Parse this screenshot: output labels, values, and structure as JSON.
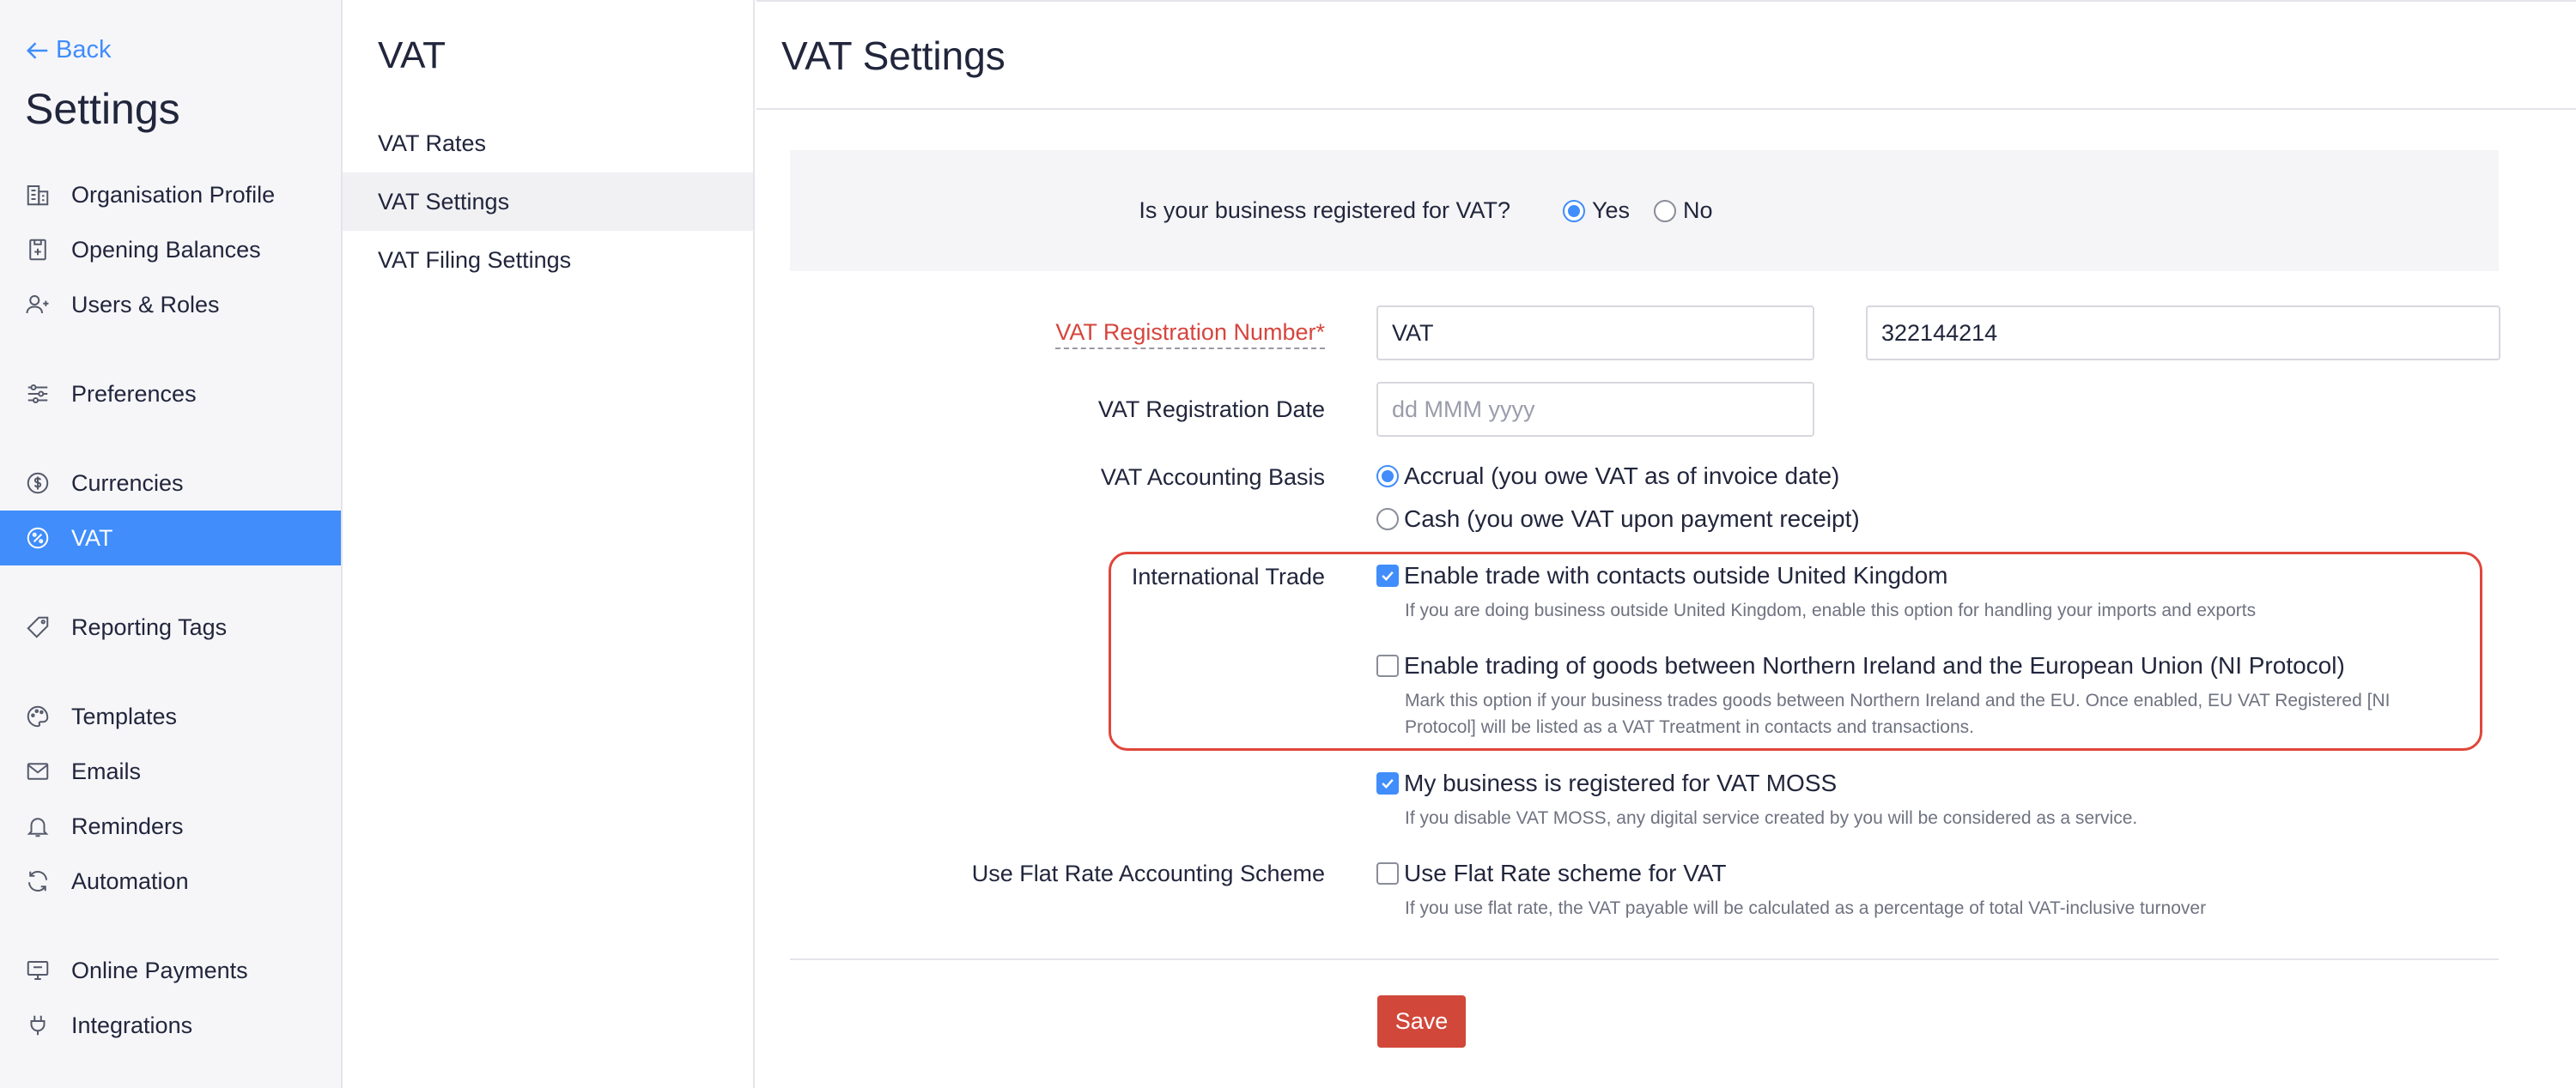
{
  "nav": {
    "back_label": "Back",
    "title": "Settings",
    "items": [
      {
        "label": "Organisation Profile",
        "icon": "building-icon"
      },
      {
        "label": "Opening Balances",
        "icon": "ledger-icon"
      },
      {
        "label": "Users & Roles",
        "icon": "users-icon"
      },
      {
        "label": "Preferences",
        "icon": "sliders-icon"
      },
      {
        "label": "Currencies",
        "icon": "currency-icon"
      },
      {
        "label": "VAT",
        "icon": "percent-icon"
      },
      {
        "label": "Reporting Tags",
        "icon": "tag-icon"
      },
      {
        "label": "Templates",
        "icon": "palette-icon"
      },
      {
        "label": "Emails",
        "icon": "mail-icon"
      },
      {
        "label": "Reminders",
        "icon": "bell-icon"
      },
      {
        "label": "Automation",
        "icon": "refresh-icon"
      },
      {
        "label": "Online Payments",
        "icon": "monitor-icon"
      },
      {
        "label": "Integrations",
        "icon": "plug-icon"
      }
    ],
    "active": "VAT"
  },
  "subnav": {
    "title": "VAT",
    "items": [
      "VAT Rates",
      "VAT Settings",
      "VAT Filing Settings"
    ],
    "active": "VAT Settings"
  },
  "main": {
    "title": "VAT Settings",
    "registered_question": "Is your business registered for VAT?",
    "yes_label": "Yes",
    "no_label": "No",
    "registered_value": "Yes",
    "reg_number_label": "VAT Registration Number*",
    "reg_prefix_value": "VAT",
    "reg_number_value": "322144214",
    "reg_date_label": "VAT Registration Date",
    "reg_date_placeholder": "dd MMM yyyy",
    "accounting_basis_label": "VAT Accounting Basis",
    "accrual_label": "Accrual (you owe VAT as of invoice date)",
    "cash_label": "Cash (you owe VAT upon payment receipt)",
    "accounting_basis_value": "Accrual",
    "international_trade_label": "International Trade",
    "trade_outside_label": "Enable trade with contacts outside United Kingdom",
    "trade_outside_hint": "If you are doing business outside United Kingdom, enable this option for handling your imports and exports",
    "trade_outside_checked": true,
    "ni_protocol_label": "Enable trading of goods between Northern Ireland and the European Union (NI Protocol)",
    "ni_protocol_hint_1": "Mark this option if your business trades goods between Northern Ireland and the EU. Once enabled, EU VAT Registered [NI",
    "ni_protocol_hint_2": "Protocol] will be listed as a VAT Treatment in contacts and transactions.",
    "ni_protocol_checked": false,
    "vat_moss_label": "My business is registered for VAT MOSS",
    "vat_moss_hint": "If you disable VAT MOSS, any digital service created by you will be considered as a service.",
    "vat_moss_checked": true,
    "flat_rate_label": "Use Flat Rate Accounting Scheme",
    "flat_rate_option": "Use Flat Rate scheme for VAT",
    "flat_rate_hint": "If you use flat rate, the VAT payable will be calculated as a percentage of total VAT-inclusive turnover",
    "flat_rate_checked": false,
    "save_label": "Save"
  },
  "colors": {
    "accent": "#408dfb",
    "save": "#d1473a",
    "required": "#d6453d",
    "highlight_border": "#e0463a"
  }
}
